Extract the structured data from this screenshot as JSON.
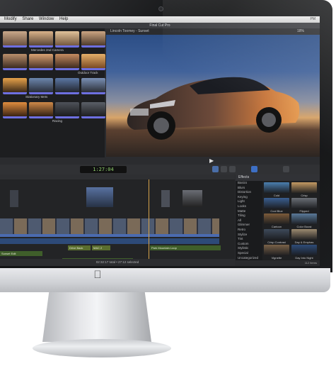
{
  "menubar": {
    "items": [
      "Modify",
      "Share",
      "Window",
      "Help"
    ],
    "right": "PM"
  },
  "window_title": "Final Cut Pro",
  "browser": {
    "event_labels": [
      "Mercedes 2nd Camera",
      "Outdoor Track",
      "Stationary Mets",
      "Racing"
    ]
  },
  "viewer": {
    "title": "Lincoln Toomey - Sunset",
    "zoom": "18%"
  },
  "toolbar": {
    "timecode": "1:27:04"
  },
  "timeline": {
    "titles": [
      "Drive Back",
      "M&C 2",
      "Sunset Edit",
      "Park Mountain Loop",
      "Spot Angle Long"
    ]
  },
  "effects": {
    "header": "Effects",
    "categories": [
      "Basics",
      "Blurs",
      "Distortion",
      "Keying",
      "Light",
      "Looks",
      "Matte",
      "Tiling",
      "All",
      "Glimmer",
      "Retro",
      "Stylize",
      "Tint",
      "Custom",
      "Stylistic",
      "Special",
      "Uncategorized"
    ],
    "items": [
      {
        "name": "Cold",
        "color": "#4a7fb0"
      },
      {
        "name": "Crisp",
        "color": "#c59b63"
      },
      {
        "name": "Cool Blue",
        "color": "#3a5f91"
      },
      {
        "name": "Flipped",
        "color": "#6b6f76"
      },
      {
        "name": "Cartoon",
        "color": "#7c5b3a"
      },
      {
        "name": "Color Boost",
        "color": "#5a7a9a"
      },
      {
        "name": "Crisp Contrast",
        "color": "#3e4a5a"
      },
      {
        "name": "Day & Emphas",
        "color": "#9c8a70"
      },
      {
        "name": "Vignette",
        "color": "#7a6248"
      },
      {
        "name": "Day Into Night",
        "color": "#2e4b78"
      }
    ],
    "footer": "112 Items"
  },
  "statusbar": "02:32:17 total  •  27:12 selected"
}
